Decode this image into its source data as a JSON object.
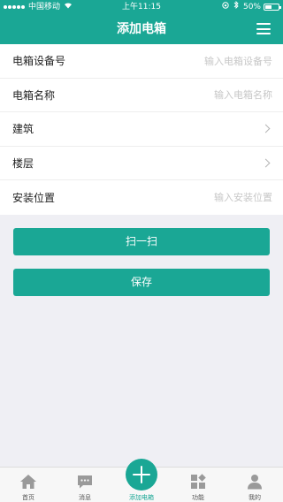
{
  "status_bar": {
    "carrier": "中国移动",
    "time": "上午11:15",
    "battery": "50%",
    "battery_level": 0.5
  },
  "header": {
    "title": "添加电箱",
    "menu_icon": "hamburger-menu-icon"
  },
  "form": {
    "fields": [
      {
        "label": "电箱设备号",
        "placeholder": "输入电箱设备号",
        "type": "input"
      },
      {
        "label": "电箱名称",
        "placeholder": "输入电箱名称",
        "type": "input"
      },
      {
        "label": "建筑",
        "type": "select"
      },
      {
        "label": "楼层",
        "type": "select"
      },
      {
        "label": "安装位置",
        "placeholder": "输入安装位置",
        "type": "input"
      }
    ]
  },
  "buttons": {
    "scan": "扫一扫",
    "save": "保存"
  },
  "tabbar": {
    "items": [
      {
        "label": "首页",
        "icon": "home-icon"
      },
      {
        "label": "消息",
        "icon": "message-icon"
      },
      {
        "label": "添加电箱",
        "icon": "plus-icon"
      },
      {
        "label": "功能",
        "icon": "grid-icon"
      },
      {
        "label": "我的",
        "icon": "user-icon"
      }
    ]
  },
  "colors": {
    "accent": "#1aa795",
    "background": "#efeff4"
  }
}
